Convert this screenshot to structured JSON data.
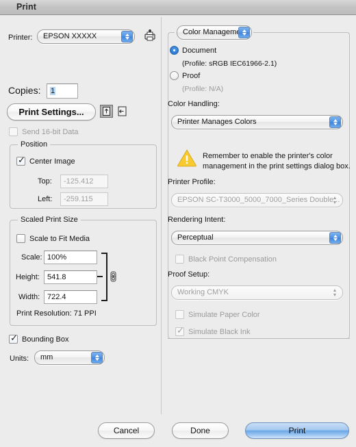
{
  "window": {
    "title": "Print"
  },
  "left": {
    "printer_label": "Printer:",
    "printer_value": "EPSON XXXXX",
    "printer_setup_icon": "printer-setup-icon",
    "copies_label": "Copies:",
    "copies_value": "1",
    "print_settings_button": "Print Settings...",
    "orientation_portrait_icon": "orientation-portrait-icon",
    "orientation_landscape_icon": "orientation-landscape-icon",
    "send_16bit_label": "Send 16-bit Data",
    "send_16bit_checked": false,
    "position": {
      "group_title": "Position",
      "center_image_label": "Center Image",
      "center_image_checked": true,
      "top_label": "Top:",
      "top_value": "-125.412",
      "left_label": "Left:",
      "left_value": "-259.115"
    },
    "scaled_print_size": {
      "group_title": "Scaled Print Size",
      "scale_to_fit_label": "Scale to Fit Media",
      "scale_to_fit_checked": false,
      "scale_label": "Scale:",
      "scale_value": "100%",
      "height_label": "Height:",
      "height_value": "541.8",
      "width_label": "Width:",
      "width_value": "722.4",
      "link_icon": "chain-link-icon",
      "print_resolution": "Print Resolution: 71 PPI"
    },
    "bounding_box_label": "Bounding Box",
    "bounding_box_checked": true,
    "units_label": "Units:",
    "units_value": "mm"
  },
  "right": {
    "section_popup": "Color Management",
    "document_radio_label": "Document",
    "document_profile": "(Profile: sRGB IEC61966-2.1)",
    "document_selected": true,
    "proof_radio_label": "Proof",
    "proof_profile": "(Profile: N/A)",
    "proof_selected": false,
    "color_handling_label": "Color Handling:",
    "color_handling_value": "Printer Manages Colors",
    "warning_icon": "warning-triangle-icon",
    "warning_text_line1": "Remember to enable the printer's color",
    "warning_text_line2": "management in the print settings dialog box.",
    "printer_profile_label": "Printer Profile:",
    "printer_profile_value": "EPSON SC-T3000_5000_7000_Series Double...",
    "rendering_intent_label": "Rendering Intent:",
    "rendering_intent_value": "Perceptual",
    "black_point_label": "Black Point Compensation",
    "black_point_checked": false,
    "proof_setup_label": "Proof Setup:",
    "proof_setup_value": "Working CMYK",
    "simulate_paper_label": "Simulate Paper Color",
    "simulate_paper_checked": false,
    "simulate_black_label": "Simulate Black Ink",
    "simulate_black_checked": true
  },
  "footer": {
    "cancel_label": "Cancel",
    "done_label": "Done",
    "print_label": "Print"
  },
  "colors": {
    "accent_blue": "#4f92e3",
    "warning_yellow": "#f5c638",
    "window_bg": "#ececec",
    "default_button": "#6ba7e6"
  }
}
